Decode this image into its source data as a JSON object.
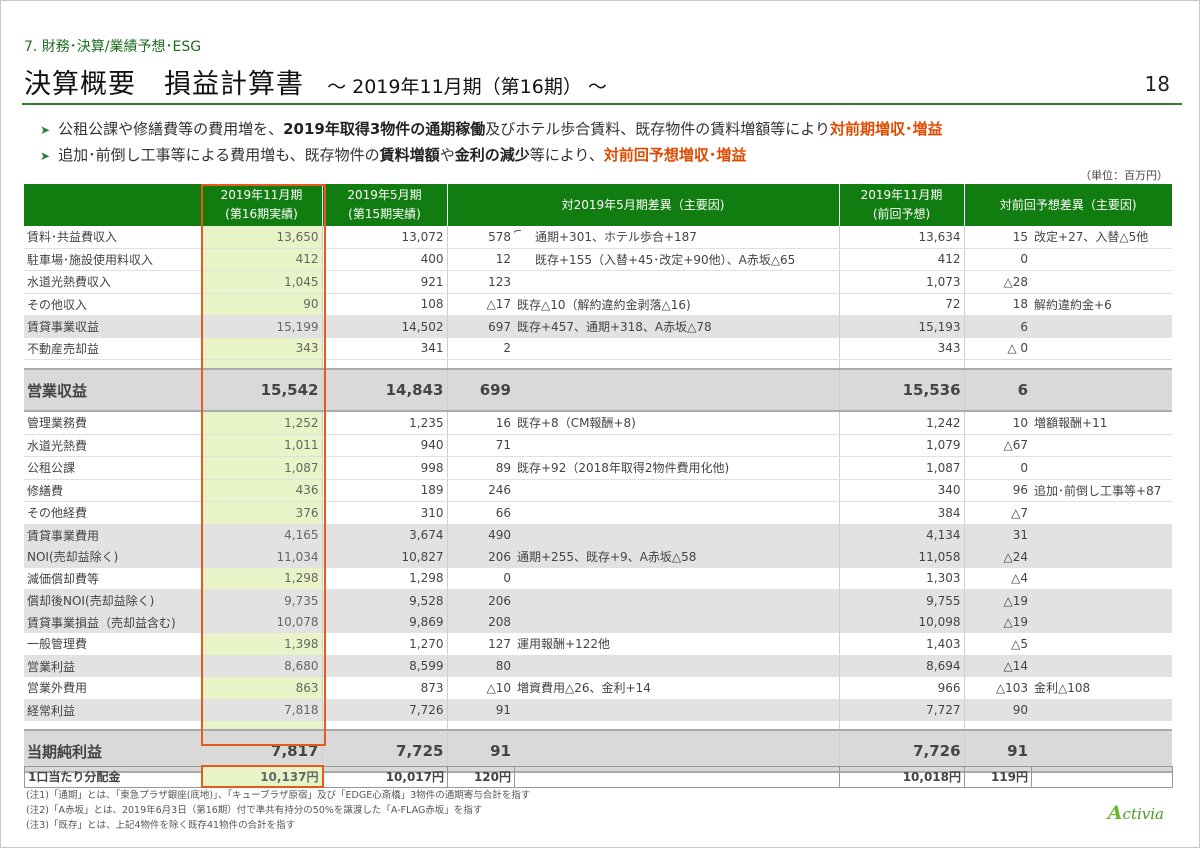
{
  "header": {
    "section": "7. 財務･決算/業績予想･ESG",
    "title": "決算概要　損益計算書",
    "subtitle": "～ 2019年11月期（第16期） ～",
    "page": "18"
  },
  "bullets": [
    {
      "pre": "公租公課や修繕費等の費用増を、",
      "bold": "2019年取得3物件の通期稼働",
      "mid": "及びホテル歩合賃料、既存物件の賃料増額等により",
      "hl": "対前期増収･増益"
    },
    {
      "pre": "追加･前倒し工事等による費用増も、既存物件の",
      "bold1": "賃料増額",
      "mid1": "や",
      "bold2": "金利の減少",
      "mid2": "等により、",
      "hl": "対前回予想増収･増益"
    }
  ],
  "unit": "（単位：百万円）",
  "columns": {
    "c16": "2019年11月期",
    "c16b": "(第16期実績)",
    "c15": "2019年5月期",
    "c15b": "(第15期実績)",
    "diff": "対2019年5月期差異（主要因)",
    "fc": "2019年11月期",
    "fcb": "(前回予想)",
    "fdiff": "対前回予想差異（主要因)"
  },
  "rows": [
    {
      "label": "賃料･共益費収入",
      "v16": "13,650",
      "v15": "13,072",
      "d": "578",
      "dr": "通期+301、ホテル歩合+187",
      "f": "13,634",
      "fd": "15",
      "fr": "改定+27、入替△5他"
    },
    {
      "label": "駐車場･施設使用料収入",
      "v16": "412",
      "v15": "400",
      "d": "12",
      "dr": "既存+155（入替+45･改定+90他）、A赤坂△65",
      "f": "412",
      "fd": "0",
      "fr": ""
    },
    {
      "label": "水道光熱費収入",
      "v16": "1,045",
      "v15": "921",
      "d": "123",
      "dr": "",
      "f": "1,073",
      "fd": "△28",
      "fr": ""
    },
    {
      "label": "その他収入",
      "v16": "90",
      "v15": "108",
      "d": "△17",
      "dr": "既存△10（解約違約金剥落△16)",
      "f": "72",
      "fd": "18",
      "fr": "解約違約金+6"
    },
    {
      "label": "賃貸事業収益",
      "v16": "15,199",
      "v15": "14,502",
      "d": "697",
      "dr": "既存+457、通期+318、A赤坂△78",
      "f": "15,193",
      "fd": "6",
      "fr": ""
    },
    {
      "label": "不動産売却益",
      "v16": "343",
      "v15": "341",
      "d": "2",
      "dr": "",
      "f": "343",
      "fd": "△ 0",
      "fr": ""
    },
    {
      "label": "営業収益",
      "v16": "15,542",
      "v15": "14,843",
      "d": "699",
      "dr": "",
      "f": "15,536",
      "fd": "6",
      "fr": ""
    },
    {
      "label": "管理業務費",
      "v16": "1,252",
      "v15": "1,235",
      "d": "16",
      "dr": "既存+8（CM報酬+8)",
      "f": "1,242",
      "fd": "10",
      "fr": "増額報酬+11"
    },
    {
      "label": "水道光熱費",
      "v16": "1,011",
      "v15": "940",
      "d": "71",
      "dr": "",
      "f": "1,079",
      "fd": "△67",
      "fr": ""
    },
    {
      "label": "公租公課",
      "v16": "1,087",
      "v15": "998",
      "d": "89",
      "dr": "既存+92（2018年取得2物件費用化他)",
      "f": "1,087",
      "fd": "0",
      "fr": ""
    },
    {
      "label": "修繕費",
      "v16": "436",
      "v15": "189",
      "d": "246",
      "dr": "",
      "f": "340",
      "fd": "96",
      "fr": "追加･前倒し工事等+87"
    },
    {
      "label": "その他経費",
      "v16": "376",
      "v15": "310",
      "d": "66",
      "dr": "",
      "f": "384",
      "fd": "△7",
      "fr": ""
    },
    {
      "label": "賃貸事業費用",
      "v16": "4,165",
      "v15": "3,674",
      "d": "490",
      "dr": "",
      "f": "4,134",
      "fd": "31",
      "fr": ""
    },
    {
      "label": "NOI(売却益除く)",
      "v16": "11,034",
      "v15": "10,827",
      "d": "206",
      "dr": "通期+255、既存+9、A赤坂△58",
      "f": "11,058",
      "fd": "△24",
      "fr": ""
    },
    {
      "label": "減価償却費等",
      "v16": "1,298",
      "v15": "1,298",
      "d": "0",
      "dr": "",
      "f": "1,303",
      "fd": "△4",
      "fr": ""
    },
    {
      "label": "償却後NOI(売却益除く)",
      "v16": "9,735",
      "v15": "9,528",
      "d": "206",
      "dr": "",
      "f": "9,755",
      "fd": "△19",
      "fr": ""
    },
    {
      "label": "賃貸事業損益（売却益含む)",
      "v16": "10,078",
      "v15": "9,869",
      "d": "208",
      "dr": "",
      "f": "10,098",
      "fd": "△19",
      "fr": ""
    },
    {
      "label": "一般管理費",
      "v16": "1,398",
      "v15": "1,270",
      "d": "127",
      "dr": "運用報酬+122他",
      "f": "1,403",
      "fd": "△5",
      "fr": ""
    },
    {
      "label": "営業利益",
      "v16": "8,680",
      "v15": "8,599",
      "d": "80",
      "dr": "",
      "f": "8,694",
      "fd": "△14",
      "fr": ""
    },
    {
      "label": "営業外費用",
      "v16": "863",
      "v15": "873",
      "d": "△10",
      "dr": "増資費用△26、金利+14",
      "f": "966",
      "fd": "△103",
      "fr": "金利△108"
    },
    {
      "label": "経常利益",
      "v16": "7,818",
      "v15": "7,726",
      "d": "91",
      "dr": "",
      "f": "7,727",
      "fd": "90",
      "fr": ""
    },
    {
      "label": "当期純利益",
      "v16": "7,817",
      "v15": "7,725",
      "d": "91",
      "dr": "",
      "f": "7,726",
      "fd": "91",
      "fr": ""
    }
  ],
  "distribution": {
    "label": "1口当たり分配金",
    "v16": "10,137円",
    "v15": "10,017円",
    "d": "120円",
    "f": "10,018円",
    "fd": "119円"
  },
  "notes": [
    "(注1)「通期」とは、「東急プラザ銀座(底地)」、「キューブラザ原宿」及び「EDGE心斎橋」3物件の通期寄与合計を指す",
    "(注2)「A赤坂」とは、2019年6月3日（第16期）付で準共有持分の50%を譲渡した「A-FLAG赤坂」を指す",
    "(注3)「既存」とは、上記4物件を除く既存41物件の合計を指す"
  ],
  "logo": {
    "initial": "A",
    "rest": "ctivia"
  }
}
